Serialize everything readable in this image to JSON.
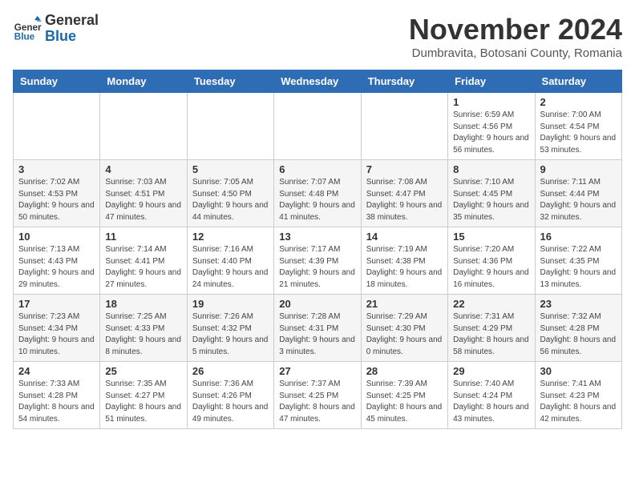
{
  "logo": {
    "general": "General",
    "blue": "Blue"
  },
  "title": "November 2024",
  "subtitle": "Dumbravita, Botosani County, Romania",
  "days_of_week": [
    "Sunday",
    "Monday",
    "Tuesday",
    "Wednesday",
    "Thursday",
    "Friday",
    "Saturday"
  ],
  "weeks": [
    [
      {
        "day": "",
        "info": ""
      },
      {
        "day": "",
        "info": ""
      },
      {
        "day": "",
        "info": ""
      },
      {
        "day": "",
        "info": ""
      },
      {
        "day": "",
        "info": ""
      },
      {
        "day": "1",
        "info": "Sunrise: 6:59 AM\nSunset: 4:56 PM\nDaylight: 9 hours and 56 minutes."
      },
      {
        "day": "2",
        "info": "Sunrise: 7:00 AM\nSunset: 4:54 PM\nDaylight: 9 hours and 53 minutes."
      }
    ],
    [
      {
        "day": "3",
        "info": "Sunrise: 7:02 AM\nSunset: 4:53 PM\nDaylight: 9 hours and 50 minutes."
      },
      {
        "day": "4",
        "info": "Sunrise: 7:03 AM\nSunset: 4:51 PM\nDaylight: 9 hours and 47 minutes."
      },
      {
        "day": "5",
        "info": "Sunrise: 7:05 AM\nSunset: 4:50 PM\nDaylight: 9 hours and 44 minutes."
      },
      {
        "day": "6",
        "info": "Sunrise: 7:07 AM\nSunset: 4:48 PM\nDaylight: 9 hours and 41 minutes."
      },
      {
        "day": "7",
        "info": "Sunrise: 7:08 AM\nSunset: 4:47 PM\nDaylight: 9 hours and 38 minutes."
      },
      {
        "day": "8",
        "info": "Sunrise: 7:10 AM\nSunset: 4:45 PM\nDaylight: 9 hours and 35 minutes."
      },
      {
        "day": "9",
        "info": "Sunrise: 7:11 AM\nSunset: 4:44 PM\nDaylight: 9 hours and 32 minutes."
      }
    ],
    [
      {
        "day": "10",
        "info": "Sunrise: 7:13 AM\nSunset: 4:43 PM\nDaylight: 9 hours and 29 minutes."
      },
      {
        "day": "11",
        "info": "Sunrise: 7:14 AM\nSunset: 4:41 PM\nDaylight: 9 hours and 27 minutes."
      },
      {
        "day": "12",
        "info": "Sunrise: 7:16 AM\nSunset: 4:40 PM\nDaylight: 9 hours and 24 minutes."
      },
      {
        "day": "13",
        "info": "Sunrise: 7:17 AM\nSunset: 4:39 PM\nDaylight: 9 hours and 21 minutes."
      },
      {
        "day": "14",
        "info": "Sunrise: 7:19 AM\nSunset: 4:38 PM\nDaylight: 9 hours and 18 minutes."
      },
      {
        "day": "15",
        "info": "Sunrise: 7:20 AM\nSunset: 4:36 PM\nDaylight: 9 hours and 16 minutes."
      },
      {
        "day": "16",
        "info": "Sunrise: 7:22 AM\nSunset: 4:35 PM\nDaylight: 9 hours and 13 minutes."
      }
    ],
    [
      {
        "day": "17",
        "info": "Sunrise: 7:23 AM\nSunset: 4:34 PM\nDaylight: 9 hours and 10 minutes."
      },
      {
        "day": "18",
        "info": "Sunrise: 7:25 AM\nSunset: 4:33 PM\nDaylight: 9 hours and 8 minutes."
      },
      {
        "day": "19",
        "info": "Sunrise: 7:26 AM\nSunset: 4:32 PM\nDaylight: 9 hours and 5 minutes."
      },
      {
        "day": "20",
        "info": "Sunrise: 7:28 AM\nSunset: 4:31 PM\nDaylight: 9 hours and 3 minutes."
      },
      {
        "day": "21",
        "info": "Sunrise: 7:29 AM\nSunset: 4:30 PM\nDaylight: 9 hours and 0 minutes."
      },
      {
        "day": "22",
        "info": "Sunrise: 7:31 AM\nSunset: 4:29 PM\nDaylight: 8 hours and 58 minutes."
      },
      {
        "day": "23",
        "info": "Sunrise: 7:32 AM\nSunset: 4:28 PM\nDaylight: 8 hours and 56 minutes."
      }
    ],
    [
      {
        "day": "24",
        "info": "Sunrise: 7:33 AM\nSunset: 4:28 PM\nDaylight: 8 hours and 54 minutes."
      },
      {
        "day": "25",
        "info": "Sunrise: 7:35 AM\nSunset: 4:27 PM\nDaylight: 8 hours and 51 minutes."
      },
      {
        "day": "26",
        "info": "Sunrise: 7:36 AM\nSunset: 4:26 PM\nDaylight: 8 hours and 49 minutes."
      },
      {
        "day": "27",
        "info": "Sunrise: 7:37 AM\nSunset: 4:25 PM\nDaylight: 8 hours and 47 minutes."
      },
      {
        "day": "28",
        "info": "Sunrise: 7:39 AM\nSunset: 4:25 PM\nDaylight: 8 hours and 45 minutes."
      },
      {
        "day": "29",
        "info": "Sunrise: 7:40 AM\nSunset: 4:24 PM\nDaylight: 8 hours and 43 minutes."
      },
      {
        "day": "30",
        "info": "Sunrise: 7:41 AM\nSunset: 4:23 PM\nDaylight: 8 hours and 42 minutes."
      }
    ]
  ]
}
